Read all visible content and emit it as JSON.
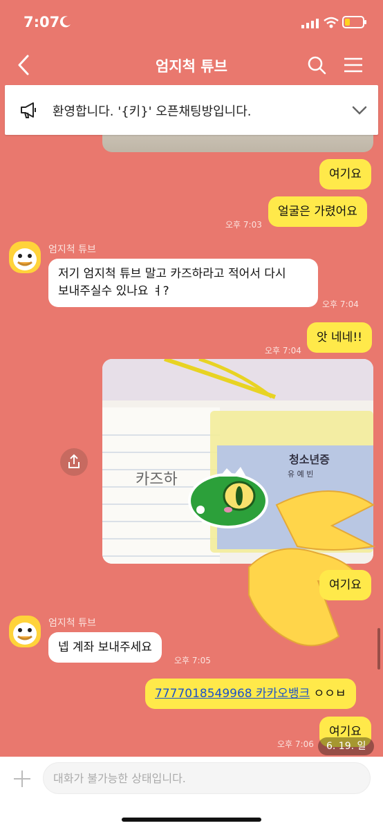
{
  "status": {
    "time": "7:07"
  },
  "header": {
    "title": "엄지척 튜브"
  },
  "notice": {
    "text": "환영합니다. '{키}' 오픈채팅방입니다."
  },
  "messages": [
    {
      "text": "여기요"
    },
    {
      "text": "얼굴은 가렸어요",
      "time": "오후 7:03"
    },
    {
      "sender": "엄지척 튜브",
      "lines": [
        "저기 엄지척 튜브 말고 카즈하라고 적어서 다시",
        "보내주실수 있나요 ㅕ?"
      ],
      "time": "오후 7:04"
    },
    {
      "text": "앗 네네!!",
      "time": "오후 7:04"
    },
    {
      "text": "여기요"
    },
    {
      "sender": "엄지척 튜브",
      "text": "넵 계좌 보내주세요",
      "time": "오후 7:05"
    },
    {
      "link": "7777018549968 카카오뱅크",
      "suffix": " ㅇㅇㅂ"
    },
    {
      "text": "여기요",
      "time": "오후 7:06"
    }
  ],
  "photo": {
    "note_text": "카즈하",
    "card_title": "청소년증",
    "card_name": "유 예 빈"
  },
  "date_chip": "6. 19. 일",
  "input": {
    "placeholder": "대화가 불가능한 상태입니다."
  },
  "colors": {
    "background": "#E9786E",
    "bubble_mine": "#FFE94A",
    "bubble_other": "#FFFFFF"
  }
}
